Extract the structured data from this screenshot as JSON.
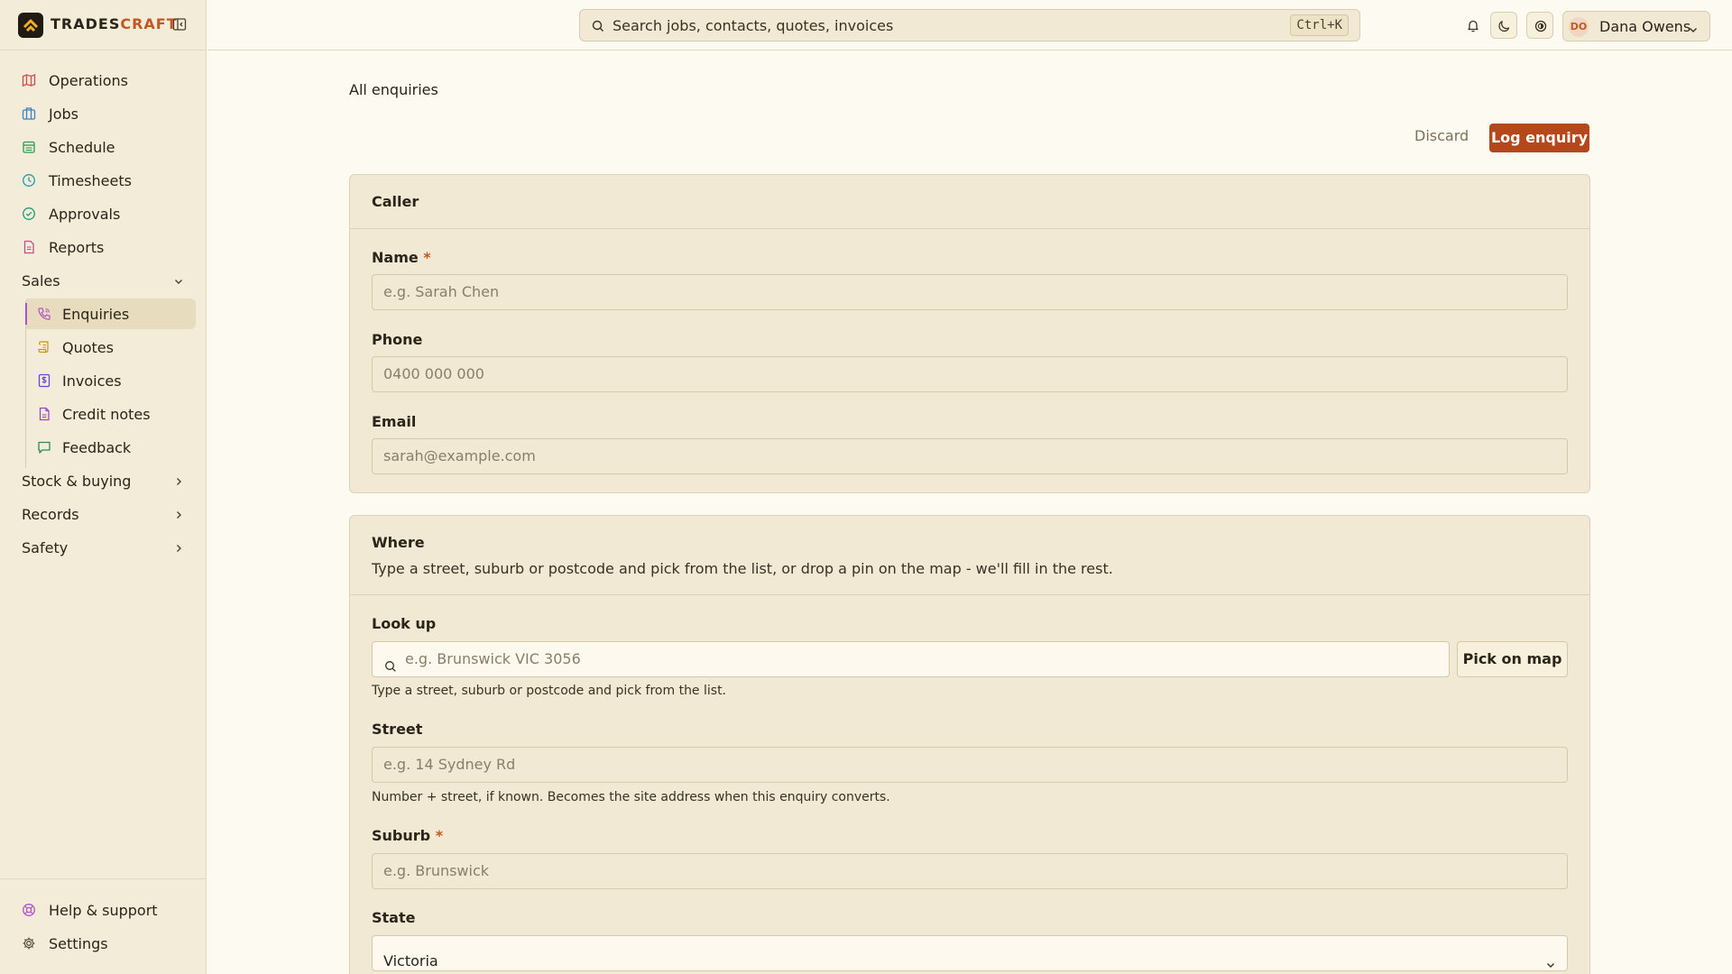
{
  "brand": {
    "name_part1": "TRADES",
    "name_part2": "CRAFT"
  },
  "nav": {
    "items": [
      {
        "label": "Operations",
        "icon": "map-icon"
      },
      {
        "label": "Jobs",
        "icon": "briefcase-icon"
      },
      {
        "label": "Schedule",
        "icon": "calendar-icon"
      },
      {
        "label": "Timesheets",
        "icon": "clock-icon"
      },
      {
        "label": "Approvals",
        "icon": "check-circle-icon"
      },
      {
        "label": "Reports",
        "icon": "report-icon"
      }
    ],
    "sales_group": "Sales",
    "sales_items": [
      {
        "label": "Enquiries",
        "icon": "phone-icon"
      },
      {
        "label": "Quotes",
        "icon": "scroll-icon"
      },
      {
        "label": "Invoices",
        "icon": "dollar-doc-icon"
      },
      {
        "label": "Credit notes",
        "icon": "file-icon"
      },
      {
        "label": "Feedback",
        "icon": "message-icon"
      }
    ],
    "groups": [
      "Stock & buying",
      "Records",
      "Safety"
    ],
    "footer": [
      {
        "label": "Help & support",
        "icon": "lifebuoy-icon"
      },
      {
        "label": "Settings",
        "icon": "gear-icon"
      }
    ]
  },
  "topbar": {
    "search_placeholder": "Search jobs, contacts, quotes, invoices",
    "shortcut": "Ctrl+K",
    "user_initials": "DO",
    "user_name": "Dana Owens"
  },
  "page": {
    "breadcrumb": "All enquiries",
    "discard_label": "Discard",
    "submit_label": "Log enquiry"
  },
  "caller": {
    "title": "Caller",
    "name_label": "Name",
    "name_placeholder": "e.g. Sarah Chen",
    "phone_label": "Phone",
    "phone_placeholder": "0400 000 000",
    "email_label": "Email",
    "email_placeholder": "sarah@example.com",
    "required_mark": "*"
  },
  "where": {
    "title": "Where",
    "subtitle": "Type a street, suburb or postcode and pick from the list, or drop a pin on the map - we'll fill in the rest.",
    "lookup_label": "Look up",
    "lookup_placeholder": "e.g. Brunswick VIC 3056",
    "pick_on_map": "Pick on map",
    "lookup_hint": "Type a street, suburb or postcode and pick from the list.",
    "street_label": "Street",
    "street_placeholder": "e.g. 14 Sydney Rd",
    "street_hint": "Number + street, if known. Becomes the site address when this enquiry converts.",
    "suburb_label": "Suburb",
    "suburb_placeholder": "e.g. Brunswick",
    "state_label": "State",
    "state_value": "Victoria"
  },
  "colors": {
    "accent": "#b5481b",
    "active_marker": "#b44fc8",
    "background": "#fdfaf1",
    "card": "#f1e9d4"
  }
}
